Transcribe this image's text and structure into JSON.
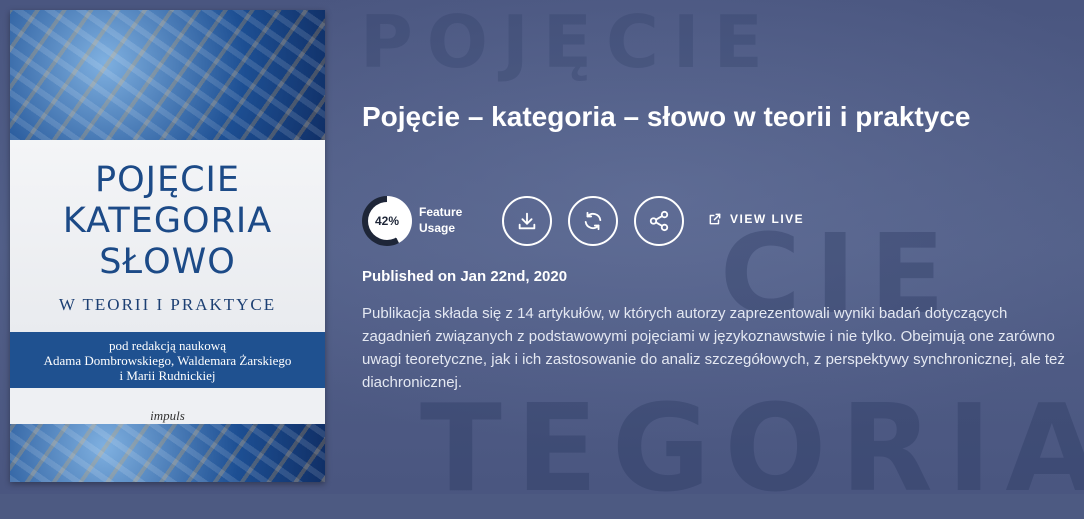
{
  "background_words": [
    "POJĘCIE",
    "CIE",
    "TEGORIA"
  ],
  "cover": {
    "title_lines": [
      "POJĘCIE",
      "KATEGORIA",
      "SŁOWO"
    ],
    "subtitle": "W TEORII I PRAKTYCE",
    "editors": [
      "pod redakcją naukową",
      "Adama Dombrowskiego, Waldemara Żarskiego",
      "i Marii Rudnickiej"
    ],
    "publisher": "impuls"
  },
  "title": "Pojęcie – kategoria – słowo w teorii i praktyce",
  "usage": {
    "percent": 42,
    "percent_label": "42%",
    "label_line1": "Feature",
    "label_line2": "Usage"
  },
  "actions": {
    "download_icon": "download-icon",
    "sync_icon": "sync-icon",
    "share_icon": "share-icon",
    "view_live_label": "VIEW LIVE"
  },
  "published": "Published on Jan 22nd, 2020",
  "description": "Publikacja składa się z 14 artykułów, w których autorzy zaprezentowali wyniki badań dotyczących zagadnień związanych z podstawowymi pojęciami w językoznawstwie i nie tylko. Obejmują one zarówno uwagi teoretyczne, jak i ich zastosowanie do analiz szczegółowych, z perspektywy synchronicznej, ale też diachronicznej.",
  "colors": {
    "background": "#4d5a82",
    "cover_blue": "#1f5190",
    "text": "#ffffff"
  }
}
